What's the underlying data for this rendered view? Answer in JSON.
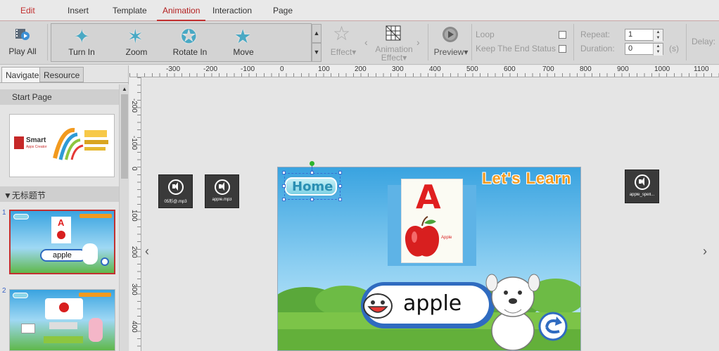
{
  "menu": {
    "items": [
      "Edit",
      "Insert",
      "Template",
      "Animation",
      "Interaction",
      "Page"
    ],
    "active": "Animation"
  },
  "toolbar": {
    "play_all": "Play All",
    "effects": [
      "Turn In",
      "Zoom",
      "Rotate In",
      "Move"
    ],
    "effect_label": "Effect",
    "animation_effect_label": [
      "Animation",
      "Effect"
    ],
    "preview_label": "Preview",
    "loop_label": "Loop",
    "keep_end_label": "Keep The End Status",
    "repeat_label": "Repeat:",
    "repeat_value": "1",
    "duration_label": "Duration:",
    "duration_value": "0",
    "duration_unit": "(s)",
    "delay_label": "Delay:"
  },
  "panel": {
    "tabs": [
      "Navigate",
      "Resource"
    ],
    "start_page": "Start Page",
    "section_title": "▼无标题节",
    "pages": [
      "1",
      "2"
    ],
    "logo_brand": "Smart",
    "logo_sub": "Apps Creator"
  },
  "ruler": {
    "h_ticks": [
      "-300",
      "-200",
      "-100",
      "0",
      "100",
      "200",
      "300",
      "400",
      "500",
      "600",
      "700",
      "800",
      "900",
      "1000",
      "1100"
    ],
    "v_ticks": [
      "-200",
      "-100",
      "0",
      "100",
      "200",
      "300",
      "400"
    ]
  },
  "canvas": {
    "audio_files": [
      "05形@.mp3",
      "apple.mp3",
      "apple_spell..."
    ]
  },
  "slide": {
    "home_label": "Home",
    "title": "Let's Learn",
    "letter": "A",
    "card_caption": "Apple",
    "word": "apple"
  },
  "colors": {
    "accent": "#c23030",
    "star": "#4aa9c4",
    "title_orange": "#f29a1f"
  }
}
